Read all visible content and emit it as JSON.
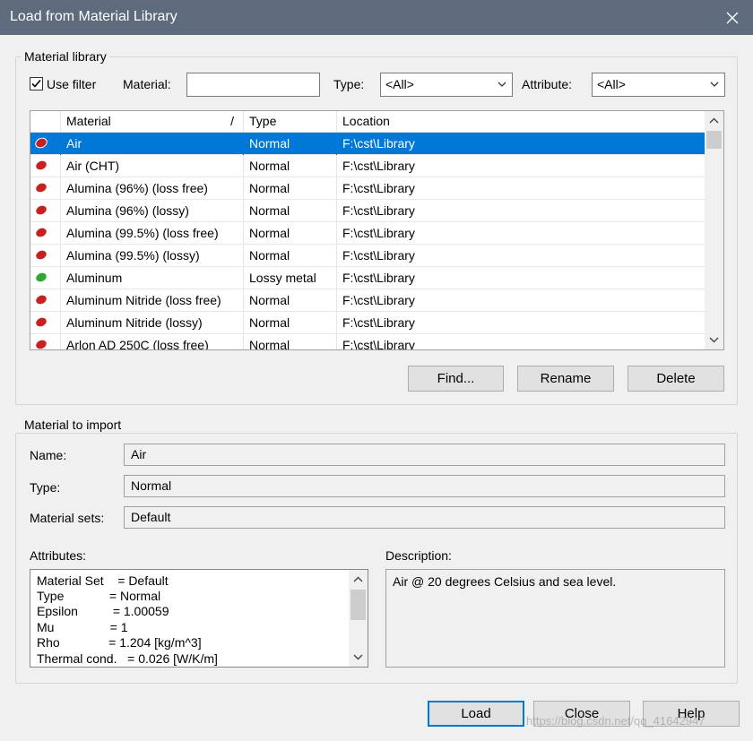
{
  "window": {
    "title": "Load from Material Library"
  },
  "library": {
    "group_label": "Material library",
    "use_filter_label": "Use filter",
    "use_filter_checked": true,
    "material_label": "Material:",
    "material_value": "",
    "type_label": "Type:",
    "type_value": "<All>",
    "attribute_label": "Attribute:",
    "attribute_value": "<All>",
    "columns": [
      "Material",
      "Type",
      "Location"
    ],
    "sort_indicator": "/",
    "rows": [
      {
        "name": "Air",
        "type": "Normal",
        "location": "F:\\cst\\Library",
        "color": "#c8201e",
        "selected": true
      },
      {
        "name": "Air (CHT)",
        "type": "Normal",
        "location": "F:\\cst\\Library",
        "color": "#c8201e"
      },
      {
        "name": "Alumina (96%) (loss free)",
        "type": "Normal",
        "location": "F:\\cst\\Library",
        "color": "#c8201e"
      },
      {
        "name": "Alumina (96%) (lossy)",
        "type": "Normal",
        "location": "F:\\cst\\Library",
        "color": "#c8201e"
      },
      {
        "name": "Alumina (99.5%) (loss free)",
        "type": "Normal",
        "location": "F:\\cst\\Library",
        "color": "#c8201e"
      },
      {
        "name": "Alumina (99.5%) (lossy)",
        "type": "Normal",
        "location": "F:\\cst\\Library",
        "color": "#c8201e"
      },
      {
        "name": "Aluminum",
        "type": "Lossy metal",
        "location": "F:\\cst\\Library",
        "color": "#2ea82e"
      },
      {
        "name": "Aluminum Nitride (loss free)",
        "type": "Normal",
        "location": "F:\\cst\\Library",
        "color": "#c8201e"
      },
      {
        "name": "Aluminum Nitride (lossy)",
        "type": "Normal",
        "location": "F:\\cst\\Library",
        "color": "#c8201e"
      },
      {
        "name": "Arlon AD 250C (loss free)",
        "type": "Normal",
        "location": "F:\\cst\\Library",
        "color": "#c8201e"
      }
    ],
    "find_label": "Find...",
    "rename_label": "Rename",
    "delete_label": "Delete"
  },
  "import": {
    "group_label": "Material to import",
    "name_label": "Name:",
    "name_value": "Air",
    "type_label": "Type:",
    "type_value": "Normal",
    "sets_label": "Material sets:",
    "sets_value": "Default",
    "attributes_label": "Attributes:",
    "attributes": [
      "Material Set    = Default",
      "Type             = Normal",
      "Epsilon          = 1.00059",
      "Mu                = 1",
      "Rho              = 1.204 [kg/m^3]",
      "Thermal cond.   = 0.026 [W/K/m]"
    ],
    "description_label": "Description:",
    "description_value": "Air @ 20 degrees Celsius and sea level."
  },
  "footer": {
    "load_label": "Load",
    "close_label": "Close",
    "help_label": "Help",
    "watermark": "https://blog.csdn.net/qq_41642947"
  },
  "colors": {
    "titlebar": "#5e6b7d",
    "selection": "#0078d7"
  }
}
